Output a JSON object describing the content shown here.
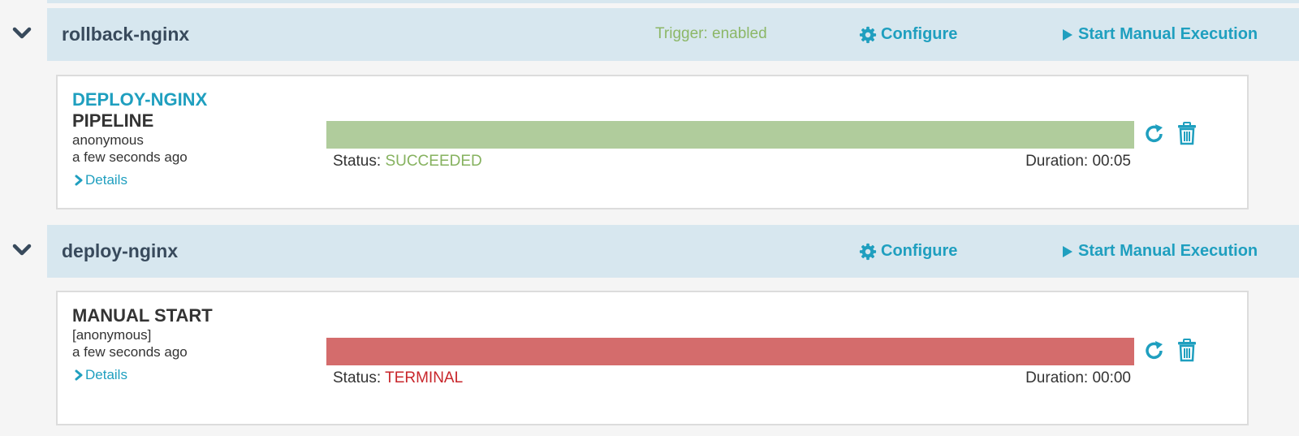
{
  "colors": {
    "accent": "#1f9fbf",
    "header_bg": "#d7e7ef",
    "trigger_green": "#8cb767",
    "success_bar": "#b0cc9c",
    "success_text": "#86b25f",
    "terminal_bar": "#d46c6c",
    "terminal_text": "#c8262b"
  },
  "groups": [
    {
      "title": "rollback-nginx",
      "trigger": "Trigger: enabled",
      "configure_label": "Configure",
      "start_label": "Start Manual Execution",
      "execution": {
        "link": "DEPLOY-NGINX",
        "type": "PIPELINE",
        "user": "anonymous",
        "time": "a few seconds ago",
        "details_label": "Details",
        "status_label": "Status:",
        "status_value": "SUCCEEDED",
        "duration": "Duration: 00:05"
      }
    },
    {
      "title": "deploy-nginx",
      "configure_label": "Configure",
      "start_label": "Start Manual Execution",
      "execution": {
        "type": "MANUAL START",
        "user": "[anonymous]",
        "time": "a few seconds ago",
        "details_label": "Details",
        "status_label": "Status:",
        "status_value": "TERMINAL",
        "duration": "Duration: 00:00"
      }
    }
  ],
  "icons": {
    "collapse": "chevron-down-icon",
    "configure": "gear-icon",
    "start": "play-icon",
    "details": "chevron-right-icon",
    "restart": "refresh-icon",
    "delete": "trash-icon"
  }
}
